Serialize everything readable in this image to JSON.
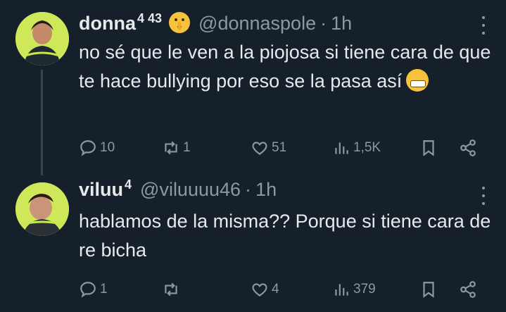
{
  "tweets": [
    {
      "name": "donna",
      "name_sup": "4 43",
      "handle": "@donnaspole",
      "time": "1h",
      "text": "no sé que le ven a la piojosa si tiene cara de que te hace bullying por eso se la pasa así",
      "replies": "10",
      "retweets": "1",
      "likes": "51",
      "views": "1,5K",
      "name_emoji_icon": "shushing-face-emoji",
      "text_emoji_icon": "grinning-face-emoji"
    },
    {
      "name": "viluu",
      "name_sup": "4",
      "handle": "@viluuuu46",
      "time": "1h",
      "text": "hablamos de la misma?? Porque si tiene cara de re bicha",
      "replies": "1",
      "retweets": "",
      "likes": "4",
      "views": "379"
    }
  ],
  "separator": "·",
  "colors": {
    "background": "#15202b",
    "text": "#e7e9ea",
    "muted": "#8b98a5",
    "avatar_ring": "#c9e64f"
  }
}
